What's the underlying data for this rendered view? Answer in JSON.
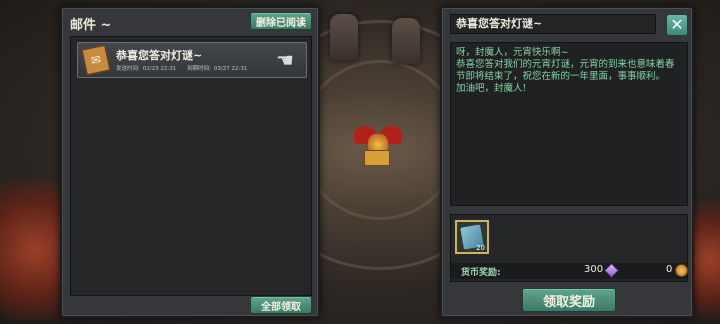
{
  "mail_list": {
    "title": "邮件 ~",
    "delete_read_label": "删除已阅读",
    "claim_all_label": "全部领取",
    "items": [
      {
        "subject": "恭喜您答对灯谜~",
        "sent_label": "发送时间:",
        "sent_time": "02/23 22:31",
        "expire_label": "到期时间:",
        "expire_time": "03/27 22:31",
        "icon": "mail-scroll-icon",
        "status_icon": "claim-hand-icon"
      }
    ]
  },
  "mail_detail": {
    "title": "恭喜您答对灯谜~",
    "close_label": "✕",
    "body_lines": [
      "呀，封魔人，元宵快乐啊~",
      "恭喜您答对我们的元宵灯谜，元宵的到来也意味着春节即将结束了，祝您在新的一年里面，事事顺利。",
      "加油吧，封魔人!"
    ],
    "reward_item": {
      "icon": "book-icon",
      "quantity": "20"
    },
    "currency_label": "货币奖励:",
    "gem_amount": "300",
    "coin_amount": "0",
    "claim_label": "领取奖励"
  },
  "colors": {
    "accent_green": "#3b7a66",
    "body_text": "#86d4a6",
    "panel_bg": "#35373a"
  }
}
